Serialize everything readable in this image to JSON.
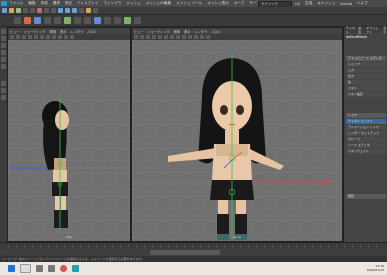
{
  "menubar": {
    "items": [
      "ファイル",
      "編集",
      "作成",
      "選択",
      "修正",
      "ディスプレイ",
      "ウィンドウ",
      "メッシュ",
      "メッシュの編集",
      "メッシュ ツール",
      "メッシュ表示",
      "カーブ",
      "サーフェス",
      "デフォーム",
      "UV",
      "生成",
      "キャッシュ",
      "Arnold",
      "ヘルプ"
    ],
    "workspace": "モデリング"
  },
  "viewport_side": {
    "menu": [
      "ビュー",
      "シェーディング",
      "照明",
      "表示",
      "レンダラ",
      "パネル"
    ],
    "camera": "side"
  },
  "viewport_persp": {
    "menu": [
      "ビュー",
      "シェーディング",
      "照明",
      "表示",
      "レンダラ",
      "パネル"
    ],
    "camera": "persp"
  },
  "channel_box": {
    "tabs": [
      "チャネル",
      "編集",
      "オブジェクト",
      "表示"
    ],
    "object": "defaultMesh",
    "rows": [
      "シェイプ",
      "入力",
      "出力",
      "色",
      "スキン",
      "スキン設定"
    ],
    "sections": [
      "アトリビュート エディタ",
      "チャネル ボックス",
      "レイヤ",
      "アニメーション レイヤ",
      "レンダー セットアップ",
      "グループ",
      "ノード エディタ",
      "スキンウェイト"
    ],
    "selected_row": "チャネル ボックス",
    "bottom_label": "選択"
  },
  "commandline": {
    "text": "ムービング: 他のフレームでのトランスフォームを保持するには、ジョイントを選択する必要があります。"
  },
  "taskbar": {
    "time": "13:36",
    "date": "2022/07/15"
  },
  "colors": {
    "axis_y": "#39c24a",
    "axis_x": "#e04040",
    "axis_z": "#3a5ed8",
    "selection": "#3a6a9e"
  }
}
